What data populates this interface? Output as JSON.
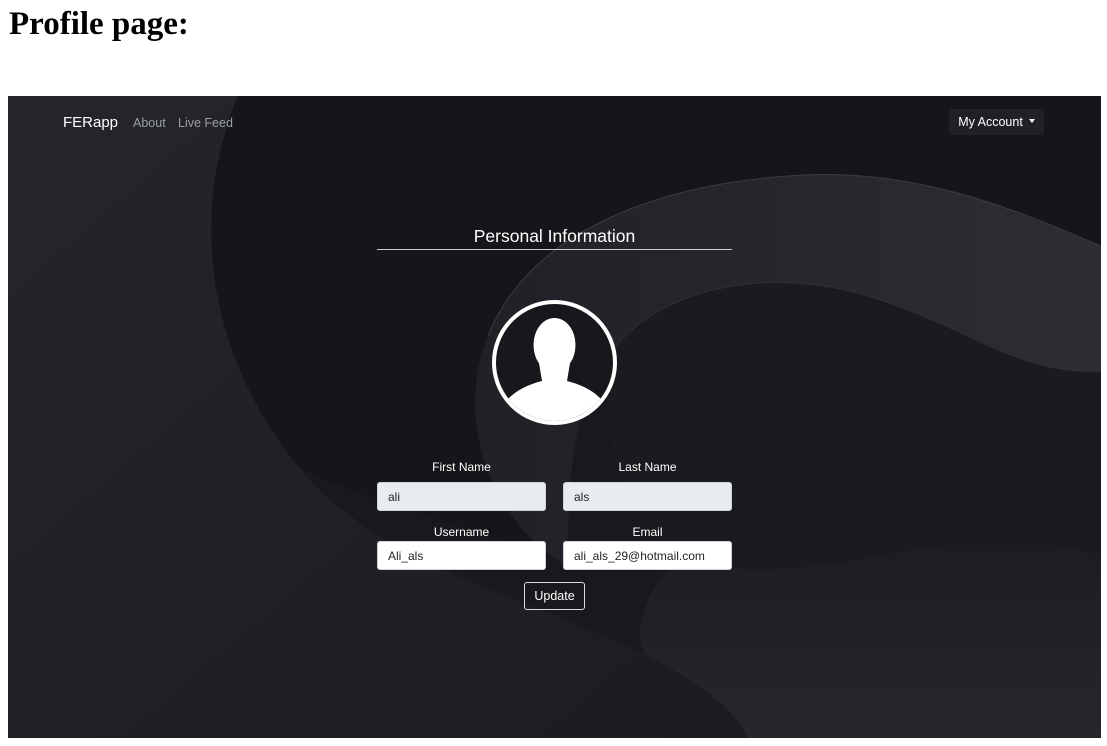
{
  "document": {
    "heading": "Profile page:"
  },
  "navbar": {
    "brand": "FERapp",
    "links": [
      {
        "label": "About"
      },
      {
        "label": "Live Feed"
      }
    ],
    "account_menu": {
      "label": "My Account",
      "icon": "chevron-down-icon"
    }
  },
  "profile": {
    "section_title": "Personal Information",
    "avatar_icon": "user-avatar-icon",
    "fields": {
      "first_name": {
        "label": "First Name",
        "value": "ali"
      },
      "last_name": {
        "label": "Last Name",
        "value": "als"
      },
      "username": {
        "label": "Username",
        "value": "Ali_als"
      },
      "email": {
        "label": "Email",
        "value": "ali_als_29@hotmail.com"
      }
    },
    "update_label": "Update"
  },
  "colors": {
    "background": "#17181c",
    "text": "#ffffff",
    "nav_link": "#9a9ea5",
    "readonly_input": "#e9ecef"
  }
}
